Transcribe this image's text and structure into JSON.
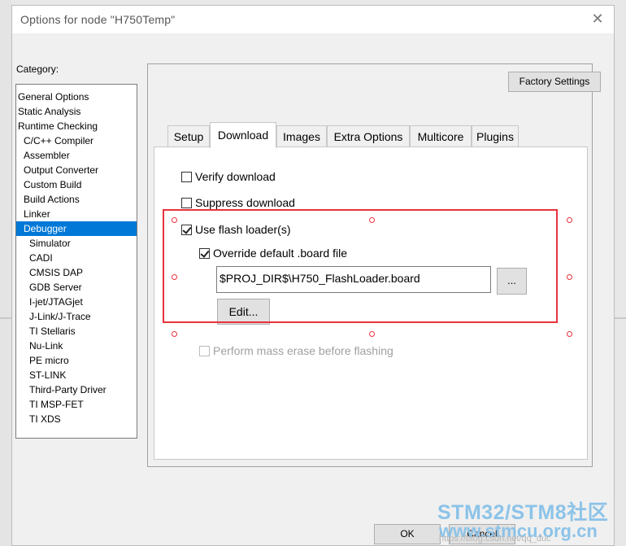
{
  "dialog": {
    "title": "Options for node \"H750Temp\"",
    "close_glyph": "✕"
  },
  "category": {
    "label": "Category:",
    "items": [
      "General Options",
      "Static Analysis",
      "Runtime Checking",
      "C/C++ Compiler",
      "Assembler",
      "Output Converter",
      "Custom Build",
      "Build Actions",
      "Linker",
      "Debugger",
      "Simulator",
      "CADI",
      "CMSIS DAP",
      "GDB Server",
      "I-jet/JTAGjet",
      "J-Link/J-Trace",
      "TI Stellaris",
      "Nu-Link",
      "PE micro",
      "ST-LINK",
      "Third-Party Driver",
      "TI MSP-FET",
      "TI XDS"
    ],
    "selected": "Debugger"
  },
  "factory_settings_label": "Factory Settings",
  "tabs": [
    "Setup",
    "Download",
    "Images",
    "Extra Options",
    "Multicore",
    "Plugins"
  ],
  "active_tab": "Download",
  "download": {
    "verify_download": {
      "label": "Verify download",
      "checked": false
    },
    "suppress_download": {
      "label": "Suppress download",
      "checked": false
    },
    "use_flash_loader": {
      "label": "Use flash loader(s)",
      "checked": true
    },
    "override_board_file": {
      "label": "Override default .board file",
      "checked": true
    },
    "board_file_path": "$PROJ_DIR$\\H750_FlashLoader.board",
    "browse_label": "...",
    "edit_label": "Edit...",
    "mass_erase": {
      "label": "Perform mass erase before flashing",
      "checked": false,
      "enabled": false
    }
  },
  "footer": {
    "ok_label": "OK",
    "cancel_label": "Cancel"
  },
  "watermark": {
    "line1": "STM32/STM8社区",
    "line2": "www.stmcu.org.cn",
    "line3": "https://blog.csdn.net/qq_duc"
  },
  "colors": {
    "selection_blue": "#0078d7",
    "annotation_red": "#e8323c",
    "watermark_blue": "#8cc3e8"
  }
}
